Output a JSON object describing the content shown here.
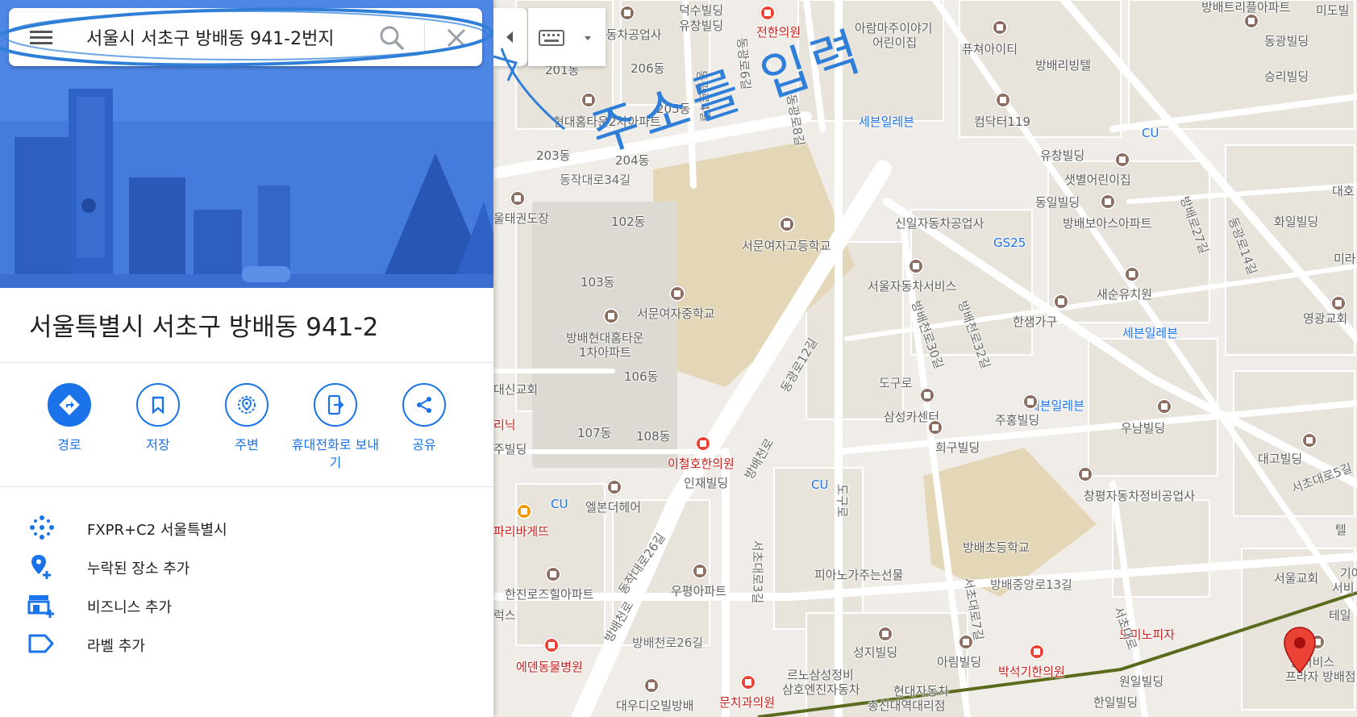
{
  "search": {
    "query": "서울시 서초구 방배동 941-2번지",
    "menu_icon": "hamburger-menu-icon",
    "search_icon": "search-icon",
    "clear_icon": "close-icon"
  },
  "place": {
    "title": "서울특별시 서초구 방배동 941-2"
  },
  "actions": [
    {
      "label": "경로",
      "icon": "directions-icon"
    },
    {
      "label": "저장",
      "icon": "bookmark-icon"
    },
    {
      "label": "주변",
      "icon": "nearby-icon"
    },
    {
      "label": "휴대전화로 보내기",
      "icon": "send-to-phone-icon"
    },
    {
      "label": "공유",
      "icon": "share-icon"
    }
  ],
  "info": [
    {
      "text": "FXPR+C2 서울특별시",
      "icon": "plus-code-icon"
    },
    {
      "text": "누락된 장소 추가",
      "icon": "add-place-icon"
    },
    {
      "text": "비즈니스 추가",
      "icon": "add-business-icon"
    },
    {
      "text": "라벨 추가",
      "icon": "label-icon"
    }
  ],
  "annotation": {
    "handwritten": "주소를 입력"
  },
  "colors": {
    "accent": "#1a73e8",
    "hero": "#4e86e6",
    "marker": "#c5221f",
    "route": "#5b6b1e"
  },
  "map_labels": {
    "l1": "덕수빌딩",
    "l2": "전한의원",
    "l3": "아람마주이야기",
    "l4": "어린이집",
    "l5": "방배트리플아파트",
    "l6": "미도빌",
    "l7": "유창빌딩",
    "l8": "동자동차공업사",
    "l9": "201동",
    "l10": "206동",
    "l11": "퓨쳐아이티",
    "l12": "동광빌딩",
    "l13": "방배리빙텔",
    "l14": "승리빌딩",
    "l15": "현대홈타운2차아파트",
    "l16": "205동",
    "l17": "세븐일레븐",
    "l18": "컴닥터119",
    "l19": "CU",
    "l20": "203동",
    "l21": "204동",
    "l22": "동작대로34길",
    "l23": "유창빌딩",
    "l24": "샛별어린이집",
    "l25": "울태권도장",
    "l26": "102동",
    "l27": "서문여자고등학교",
    "l28": "신일자동차공업사",
    "l29": "GS25",
    "l30": "동일빌딩",
    "l31": "방배보아스아파트",
    "l32": "화일빌딩",
    "l33": "103동",
    "l34": "서울자동차서비스",
    "l35": "새순유치원",
    "l36": "서문여자중학교",
    "l37": "방배현대홈타운",
    "l38": "1차아파트",
    "l39": "한샘가구",
    "l40": "세븐일레븐",
    "l41": "영광교회",
    "l42": "106동",
    "l43": "대신교회",
    "l44": "도구로",
    "l45": "세븐일레븐",
    "l46": "삼성카센터",
    "l47": "주홍빌딩",
    "l48": "우남빌딩",
    "l49": "107동",
    "l50": "108동",
    "l51": "희구빌딩",
    "l52": "이철호한의원",
    "l53": "인재빌딩",
    "l54": "CU",
    "l55": "CU",
    "l56": "엘본더헤어",
    "l57": "대고빌딩",
    "l58": "창평자동차정비공업사",
    "l59": "파리바게뜨",
    "l60": "방배초등학교",
    "l61": "피아노가주는선물",
    "l62": "한진로즈힐아파트",
    "l63": "우평아파트",
    "l64": "방배중앙로13길",
    "l65": "서울교회",
    "l66": "도미노피자",
    "l67": "방배천로26길",
    "l68": "성지빌딩",
    "l69": "아림빌딩",
    "l70": "르노삼성정비",
    "l71": "삼호엔진자동차",
    "l72": "박석기한의원",
    "l73": "에덴동물병원",
    "l74": "대우디오빌방배",
    "l75": "문치과의원",
    "l76": "현대자동차",
    "l77": "총신대역대리점",
    "l78": "원일빌딩",
    "l79": "한일빌딩",
    "l80": "용서비스",
    "l81": "프라자 방배점",
    "l82": "동작대로26길",
    "l83": "방배천로",
    "l84": "서초대로3길",
    "l85": "서초대로7길",
    "l86": "동광로12길",
    "l87": "방배천로",
    "l88": "도구로",
    "l89": "방배로27길",
    "l90": "동광로14길",
    "l91": "방배천로30길",
    "l92": "방배천로32길",
    "l93": "서초대로",
    "l94": "동광로8길",
    "l95": "동광로4길",
    "l96": "동광로6길",
    "l97": "리닉",
    "l98": "주빌딩",
    "l99": "럭스",
    "l100": "테일",
    "l101": "서초대로5길",
    "l102": "기아",
    "l103": "서비",
    "l104": "대호",
    "l105": "미라",
    "l106": "텔"
  }
}
